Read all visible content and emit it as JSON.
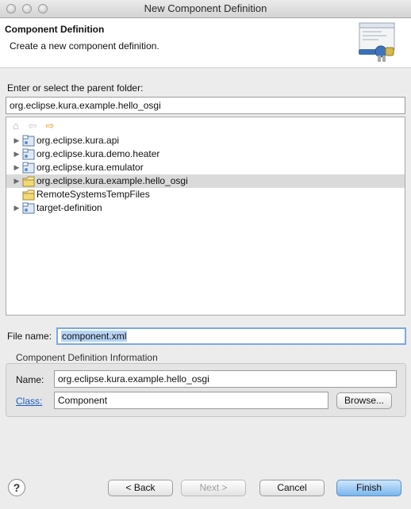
{
  "window": {
    "title": "New Component Definition",
    "traffic_lights": [
      "close",
      "minimize",
      "zoom"
    ]
  },
  "header": {
    "title": "Component Definition",
    "description": "Create a new component definition."
  },
  "parent_folder": {
    "label": "Enter or select the parent folder:",
    "value": "org.eclipse.kura.example.hello_osgi"
  },
  "tree_toolbar": [
    {
      "name": "home-icon",
      "glyph": "⌂"
    },
    {
      "name": "back-arrow-icon",
      "glyph": "⇦"
    },
    {
      "name": "forward-arrow-icon",
      "glyph": "⇨"
    }
  ],
  "tree": [
    {
      "label": "org.eclipse.kura.api",
      "expandable": true,
      "plugin_icon": true,
      "selected": false
    },
    {
      "label": "org.eclipse.kura.demo.heater",
      "expandable": true,
      "plugin_icon": true,
      "selected": false
    },
    {
      "label": "org.eclipse.kura.emulator",
      "expandable": true,
      "plugin_icon": true,
      "selected": false
    },
    {
      "label": "org.eclipse.kura.example.hello_osgi",
      "expandable": true,
      "plugin_icon": false,
      "selected": true
    },
    {
      "label": "RemoteSystemsTempFiles",
      "expandable": false,
      "plugin_icon": false,
      "selected": false
    },
    {
      "label": "target-definition",
      "expandable": true,
      "plugin_icon": true,
      "selected": false
    }
  ],
  "file_name": {
    "label": "File name:",
    "value": "component.xml"
  },
  "info_group": {
    "title": "Component Definition Information",
    "name_label": "Name:",
    "name_value": "org.eclipse.kura.example.hello_osgi",
    "class_label": "Class:",
    "class_value": "Component",
    "browse_label": "Browse..."
  },
  "buttons": {
    "back": "< Back",
    "next": "Next >",
    "cancel": "Cancel",
    "finish": "Finish",
    "help": "?"
  },
  "colors": {
    "accent_blue": "#7ab6ef",
    "link_blue": "#1a5bc4",
    "selection_gray": "#dadada"
  }
}
